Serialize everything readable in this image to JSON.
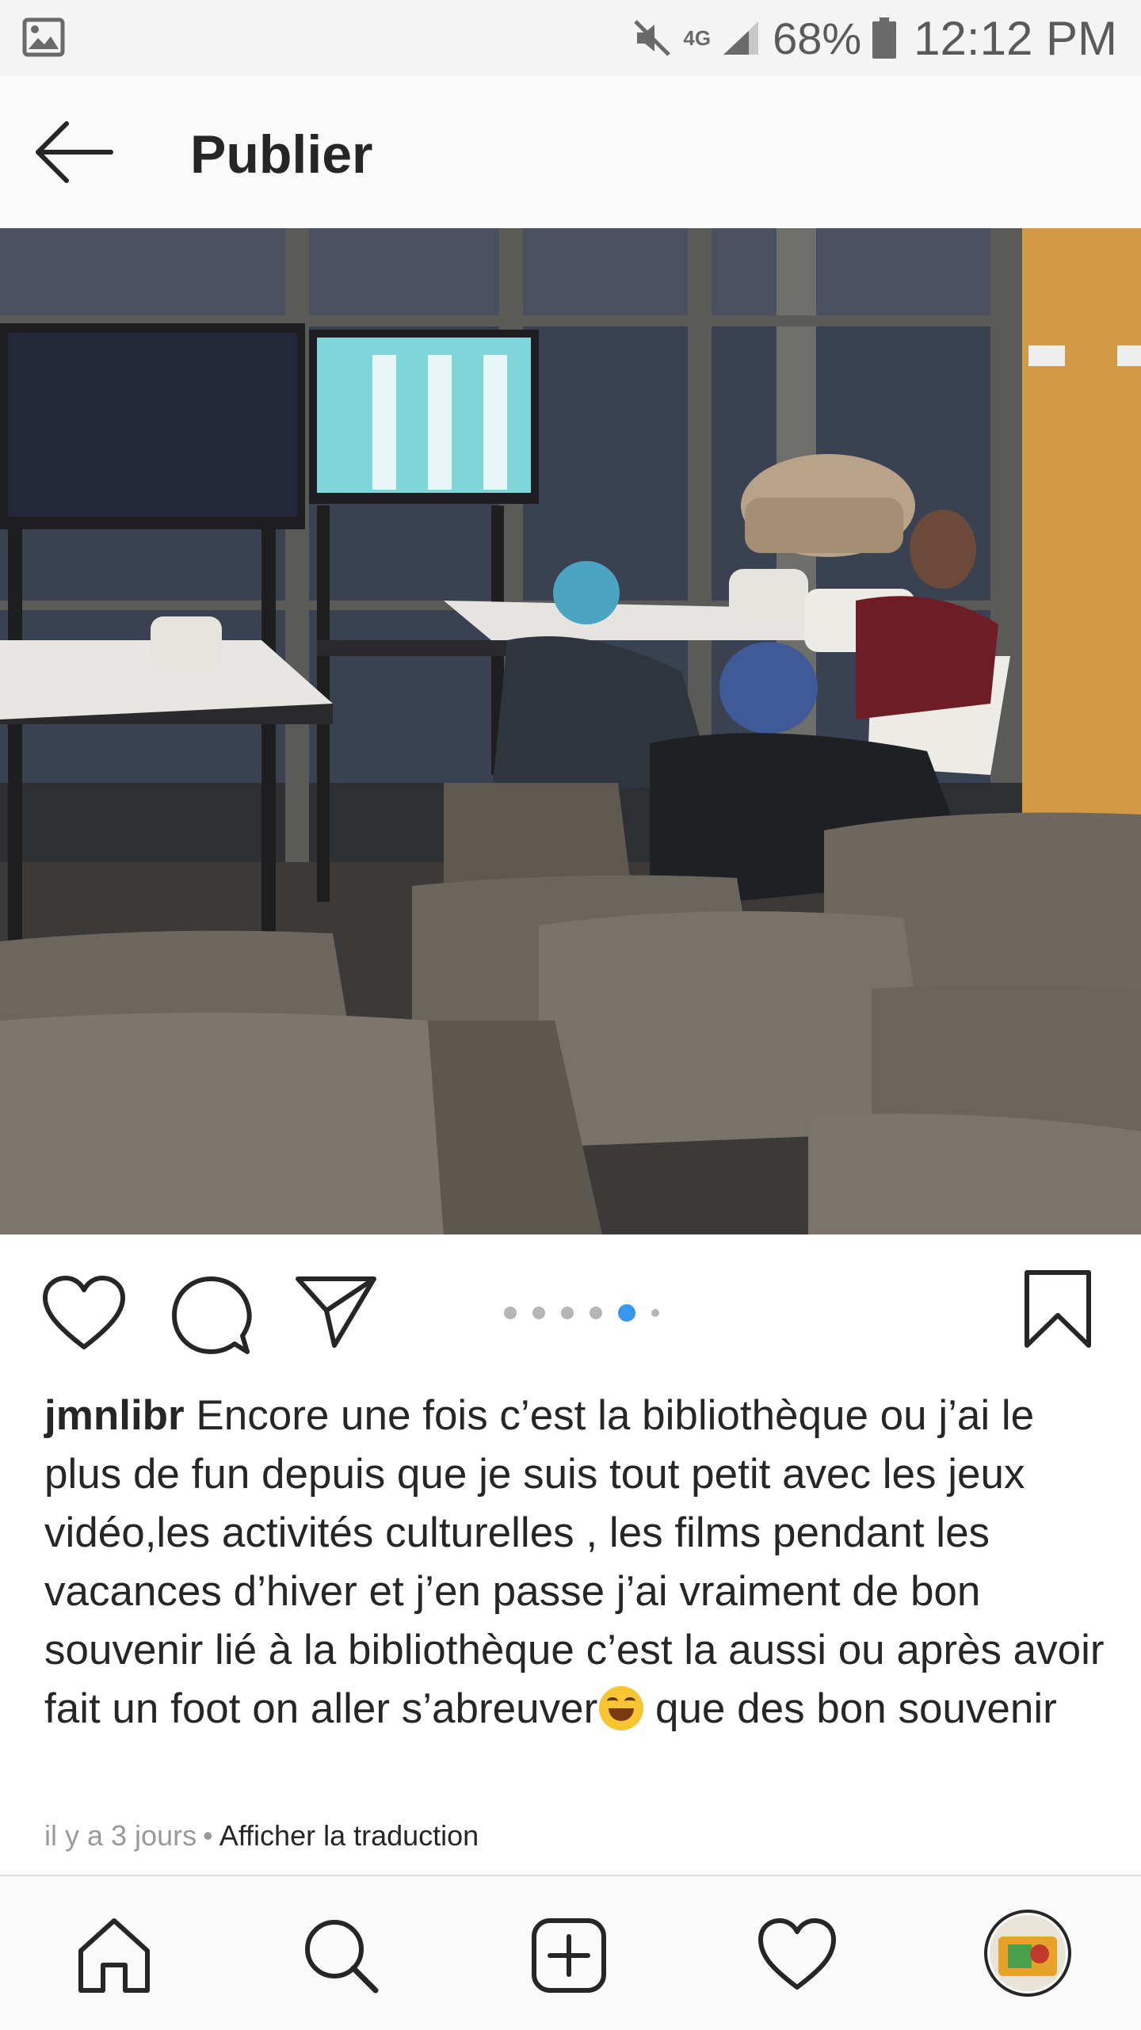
{
  "status_bar": {
    "network": "4G",
    "battery": "68%",
    "time": "12:12 PM",
    "icons": [
      "gallery-icon",
      "mute-icon",
      "signal-icon",
      "battery-icon"
    ]
  },
  "header": {
    "title": "Publier",
    "back_icon": "arrow-left-icon"
  },
  "post": {
    "image_alt": "photo",
    "carousel": {
      "count": 6,
      "active_index": 4
    },
    "actions": [
      "heart-icon",
      "comment-icon",
      "send-icon",
      "bookmark-icon"
    ],
    "username": "jmnlibr",
    "caption_before_emoji": "Encore une fois c’est la bibliothèque ou j’ai le plus de fun depuis que je suis tout petit avec les jeux vidéo,les activités culturelles , les films pendant les vacances d’hiver et j’en passe j’ai vraiment de bon souvenir lié à la bibliothèque c’est la aussi ou après avoir fait un foot on aller s’abreuver",
    "caption_after_emoji": " que des bon souvenir",
    "time_ago": "il y a 3 jours",
    "separator": "•",
    "translate_label": "Afficher la traduction"
  },
  "bottom_nav": [
    "home-icon",
    "search-icon",
    "add-icon",
    "heart-icon",
    "profile-avatar"
  ],
  "colors": {
    "accent": "#3897f0",
    "text": "#262626",
    "muted": "#999999"
  }
}
